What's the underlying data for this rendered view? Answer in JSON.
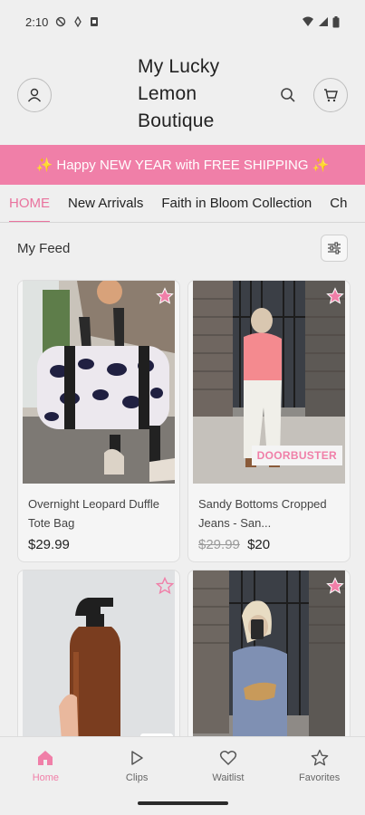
{
  "status_bar": {
    "time": "2:10"
  },
  "header": {
    "brand_title": "My Lucky Lemon Boutique"
  },
  "banner": {
    "text": "✨ Happy NEW YEAR with FREE SHIPPING ✨"
  },
  "tabs": [
    {
      "label": "HOME",
      "active": true
    },
    {
      "label": "New Arrivals"
    },
    {
      "label": "Faith in Bloom Collection"
    },
    {
      "label": "Ch"
    }
  ],
  "feed": {
    "title": "My Feed"
  },
  "products": [
    {
      "name": "Overnight Leopard Duffle Tote Bag",
      "price": "$29.99",
      "favorited": true
    },
    {
      "name": "Sandy Bottoms Cropped Jeans - San...",
      "old_price": "$29.99",
      "price": "$20",
      "badge": "DOORBUSTER",
      "favorited": true
    },
    {
      "name": "",
      "price": "",
      "favorited": false
    },
    {
      "name": "",
      "price": "",
      "favorited": true
    }
  ],
  "bottom_nav": [
    {
      "label": "Home",
      "icon": "home-icon",
      "active": true
    },
    {
      "label": "Clips",
      "icon": "play-icon"
    },
    {
      "label": "Waitlist",
      "icon": "heart-icon"
    },
    {
      "label": "Favorites",
      "icon": "star-icon"
    }
  ],
  "colors": {
    "accent": "#f07fa8",
    "background": "#efefef"
  }
}
